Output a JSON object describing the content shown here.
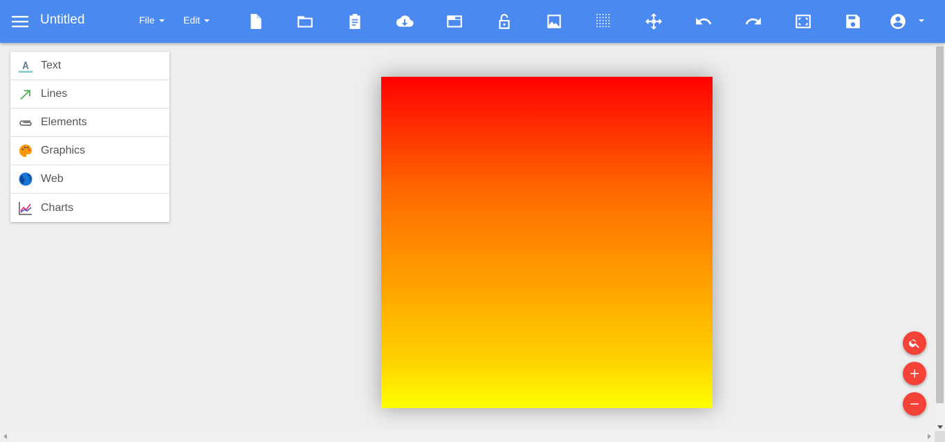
{
  "header": {
    "title": "Untitled",
    "menus": [
      {
        "label": "File"
      },
      {
        "label": "Edit"
      }
    ],
    "tools": [
      {
        "icon": "new-file-icon"
      },
      {
        "icon": "open-folder-icon"
      },
      {
        "icon": "clipboard-icon"
      },
      {
        "icon": "cloud-download-icon"
      },
      {
        "icon": "window-icon"
      },
      {
        "icon": "unlock-icon"
      },
      {
        "icon": "image-icon"
      },
      {
        "icon": "grid-icon"
      },
      {
        "icon": "move-icon"
      },
      {
        "icon": "undo-icon"
      },
      {
        "icon": "redo-icon"
      },
      {
        "icon": "fit-screen-icon"
      },
      {
        "icon": "save-icon"
      },
      {
        "icon": "account-icon"
      }
    ]
  },
  "sidebar": {
    "items": [
      {
        "label": "Text",
        "icon": "text-icon"
      },
      {
        "label": "Lines",
        "icon": "arrow-line-icon"
      },
      {
        "label": "Elements",
        "icon": "paperclip-icon"
      },
      {
        "label": "Graphics",
        "icon": "palette-icon"
      },
      {
        "label": "Web",
        "icon": "globe-icon"
      },
      {
        "label": "Charts",
        "icon": "chart-icon"
      }
    ]
  },
  "canvas": {
    "gradient_top": "#ff0000",
    "gradient_bottom": "#ffff00"
  },
  "fabs": [
    {
      "icon": "search-icon"
    },
    {
      "icon": "zoom-in-icon"
    },
    {
      "icon": "zoom-out-icon"
    }
  ],
  "colors": {
    "primary": "#4a89f0",
    "accent": "#f44336"
  }
}
